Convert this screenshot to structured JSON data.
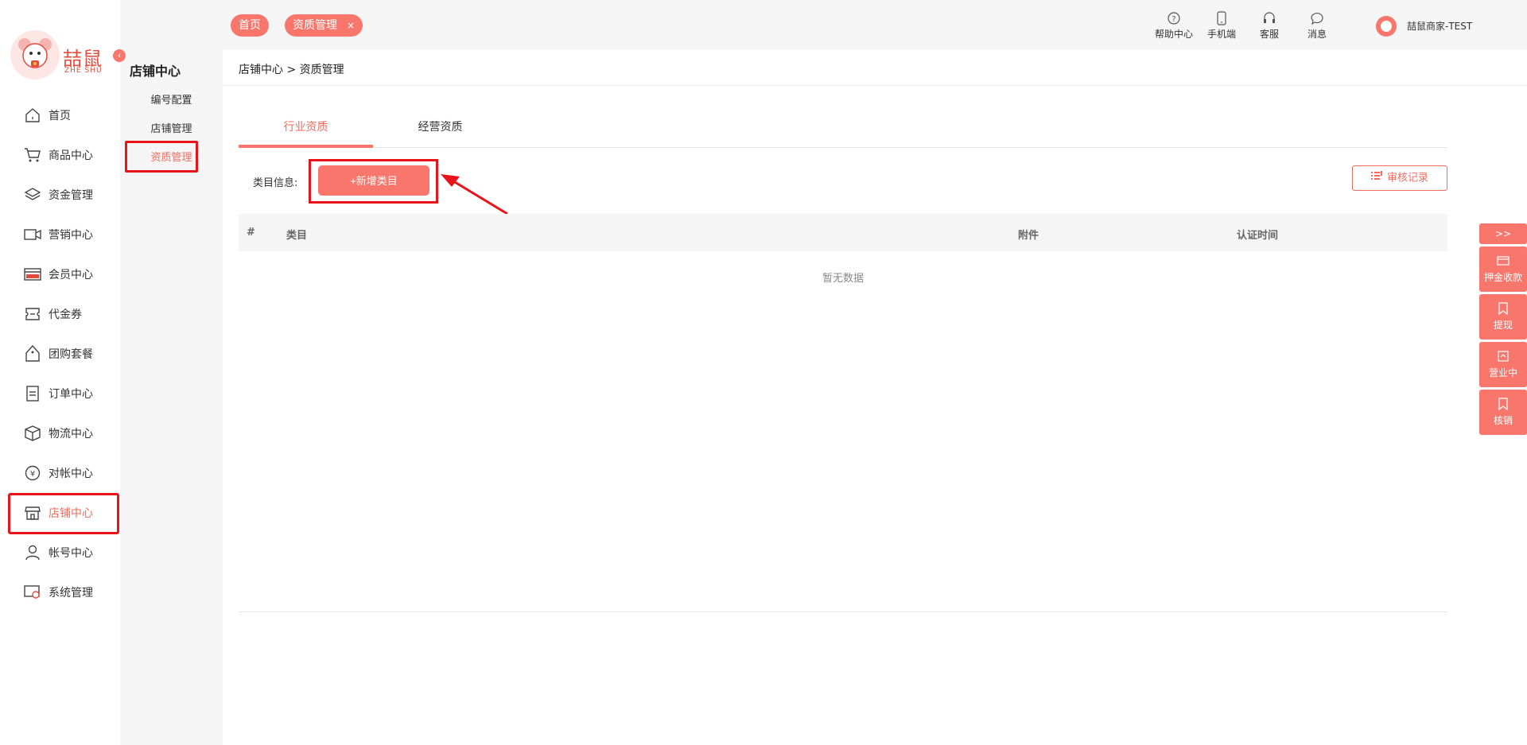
{
  "brand": {
    "name_cn": "喆鼠",
    "name_en": "ZHE SHU",
    "color": "#f8766b",
    "highlight": "#e8141a"
  },
  "sidebar": {
    "collapse_icon": "chevron-left-icon",
    "items": [
      {
        "label": "首页",
        "icon": "home-icon"
      },
      {
        "label": "商品中心",
        "icon": "cart-icon"
      },
      {
        "label": "资金管理",
        "icon": "layers-icon"
      },
      {
        "label": "营销中心",
        "icon": "marketing-icon"
      },
      {
        "label": "会员中心",
        "icon": "vip-card-icon"
      },
      {
        "label": "代金券",
        "icon": "voucher-icon"
      },
      {
        "label": "团购套餐",
        "icon": "tag-icon"
      },
      {
        "label": "订单中心",
        "icon": "order-icon"
      },
      {
        "label": "物流中心",
        "icon": "box-icon"
      },
      {
        "label": "对帐中心",
        "icon": "yen-icon"
      },
      {
        "label": "店铺中心",
        "icon": "store-icon",
        "active": true
      },
      {
        "label": "帐号中心",
        "icon": "user-icon"
      },
      {
        "label": "系统管理",
        "icon": "system-icon"
      }
    ]
  },
  "submenu": {
    "title": "店铺中心",
    "items": [
      {
        "label": "编号配置"
      },
      {
        "label": "店铺管理"
      },
      {
        "label": "资质管理",
        "active": true
      }
    ]
  },
  "header": {
    "tabs": [
      {
        "label": "首页"
      },
      {
        "label": "资质管理",
        "closable": true,
        "close": "×"
      }
    ],
    "tools": [
      {
        "label": "帮助中心",
        "icon": "help-icon"
      },
      {
        "label": "手机端",
        "icon": "phone-icon"
      },
      {
        "label": "客服",
        "icon": "headset-icon"
      },
      {
        "label": "消息",
        "icon": "message-icon"
      }
    ],
    "username": "喆鼠商家-TEST"
  },
  "main": {
    "breadcrumb": "店铺中心 > 资质管理",
    "tabs": [
      {
        "label": "行业资质",
        "active": true
      },
      {
        "label": "经营资质"
      }
    ],
    "category_label": "类目信息:",
    "add_button": "+新增类目",
    "audit_button": "审核记录",
    "table": {
      "columns": [
        "#",
        "类目",
        "附件",
        "认证时间"
      ],
      "empty_text": "暂无数据"
    }
  },
  "float_bar": {
    "toggle": ">>",
    "items": [
      {
        "label": "押金收款",
        "icon": "card-icon"
      },
      {
        "label": "提现",
        "icon": "bookmark-icon"
      },
      {
        "label": "营业中",
        "icon": "shop-icon"
      },
      {
        "label": "核销",
        "icon": "verify-icon"
      }
    ]
  }
}
